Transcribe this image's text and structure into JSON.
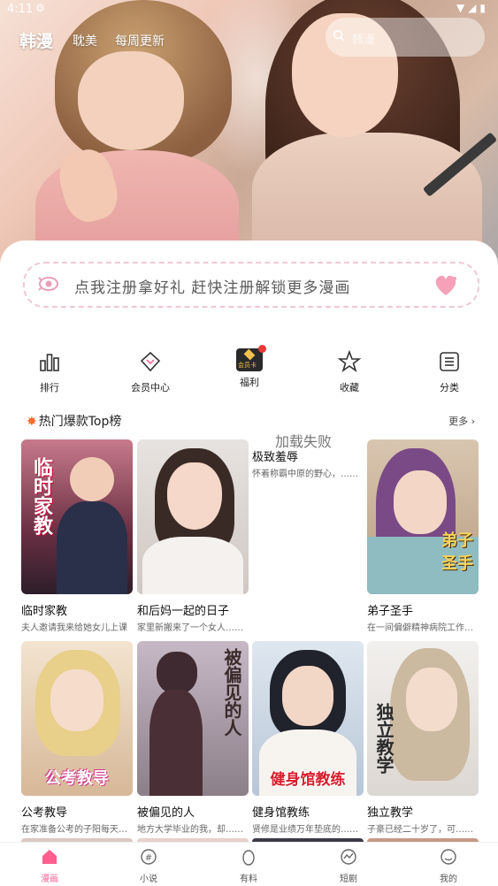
{
  "status_bar": {
    "time": "4:11"
  },
  "top_nav": {
    "tabs": [
      {
        "label": "韩漫",
        "active": true
      },
      {
        "label": "耽美",
        "active": false
      },
      {
        "label": "每周更新",
        "active": false
      }
    ],
    "search_placeholder": "韩漫"
  },
  "promo": {
    "text": "点我注册拿好礼 赶快注册解锁更多漫画"
  },
  "quick_actions": [
    {
      "label": "排行",
      "icon": "ranking-icon"
    },
    {
      "label": "会员中心",
      "icon": "membership-icon"
    },
    {
      "label": "福利",
      "icon": "vip-card-icon",
      "badge_text": "会员卡"
    },
    {
      "label": "收藏",
      "icon": "star-icon"
    },
    {
      "label": "分类",
      "icon": "category-list-icon"
    }
  ],
  "section": {
    "title": "热门爆款Top榜",
    "more": "更多"
  },
  "load_failed": "加载失败",
  "comics": [
    {
      "title": "临时家教",
      "desc": "夫人邀请我来给她女儿上课",
      "cover_text": "临时家教"
    },
    {
      "title": "和后妈一起的日子",
      "desc": "家里新搬来了一个女人……",
      "cover_text": ""
    },
    {
      "title": "极致羞辱",
      "desc": "怀着称霸中原的野心，……",
      "cover_text": ""
    },
    {
      "title": "弟子圣手",
      "desc": "在一间偏僻精神病院工作……",
      "cover_text": "弟子圣手"
    },
    {
      "title": "公考教导",
      "desc": "在家准备公考的子阳每天……",
      "cover_text": "公考教导"
    },
    {
      "title": "被偏见的人",
      "desc": "地方大学毕业的我，却……",
      "cover_text": "被偏见的人"
    },
    {
      "title": "健身馆教练",
      "desc": "贤修是业绩万年垫底的……",
      "cover_text": "健身馆教练"
    },
    {
      "title": "独立教学",
      "desc": "子豪已经二十岁了，可……",
      "cover_text": "独立教学"
    }
  ],
  "bottom_nav": [
    {
      "label": "漫画",
      "icon": "comic-icon",
      "active": true
    },
    {
      "label": "小说",
      "icon": "novel-icon",
      "active": false
    },
    {
      "label": "有料",
      "icon": "egg-icon",
      "active": false
    },
    {
      "label": "短剧",
      "icon": "drama-icon",
      "active": false
    },
    {
      "label": "我的",
      "icon": "profile-icon",
      "active": false
    }
  ],
  "colors": {
    "accent": "#ff5f8f",
    "promo_border": "#f0c8d4",
    "fire": "#ff6a2a"
  }
}
